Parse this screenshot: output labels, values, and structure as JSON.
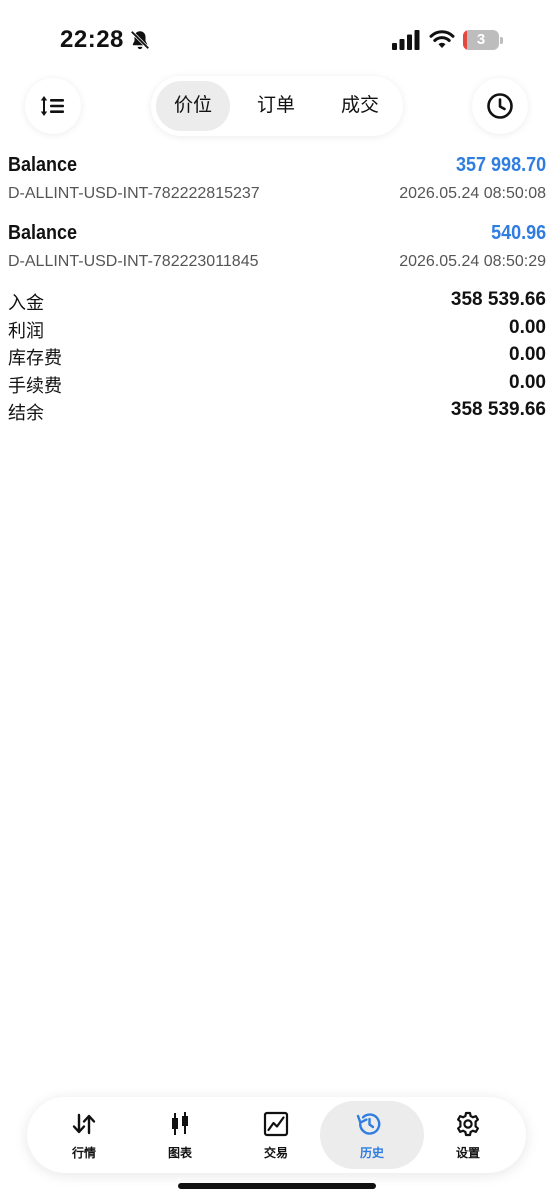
{
  "status_bar": {
    "time": "22:28",
    "battery_level": "3",
    "icons": [
      "bell-slash-icon",
      "cellular-signal-icon",
      "wifi-icon",
      "battery-icon"
    ]
  },
  "toolbar": {
    "left_icon": "sort-icon",
    "right_icon": "clock-icon",
    "segments": [
      {
        "label": "价位",
        "active": true
      },
      {
        "label": "订单",
        "active": false
      },
      {
        "label": "成交",
        "active": false
      }
    ]
  },
  "deals": [
    {
      "type": "Balance",
      "amount": "357 998.70",
      "account": "D-ALLINT-USD-INT-782222815237",
      "time": "2026.05.24 08:50:08"
    },
    {
      "type": "Balance",
      "amount": "540.96",
      "account": "D-ALLINT-USD-INT-782223011845",
      "time": "2026.05.24 08:50:29"
    }
  ],
  "summary": [
    {
      "label": "入金",
      "value": "358 539.66"
    },
    {
      "label": "利润",
      "value": "0.00"
    },
    {
      "label": "库存费",
      "value": "0.00"
    },
    {
      "label": "手续费",
      "value": "0.00"
    },
    {
      "label": "结余",
      "value": "358 539.66"
    }
  ],
  "tabbar": {
    "items": [
      {
        "label": "行情",
        "icon": "quotes-arrows-icon",
        "active": false
      },
      {
        "label": "图表",
        "icon": "candlestick-icon",
        "active": false
      },
      {
        "label": "交易",
        "icon": "trade-chart-icon",
        "active": false
      },
      {
        "label": "历史",
        "icon": "history-icon",
        "active": true
      },
      {
        "label": "设置",
        "icon": "gear-icon",
        "active": false
      }
    ]
  },
  "colors": {
    "accent": "#2f7de1",
    "active_pill": "#ececec",
    "battery_low": "#e5483f"
  }
}
